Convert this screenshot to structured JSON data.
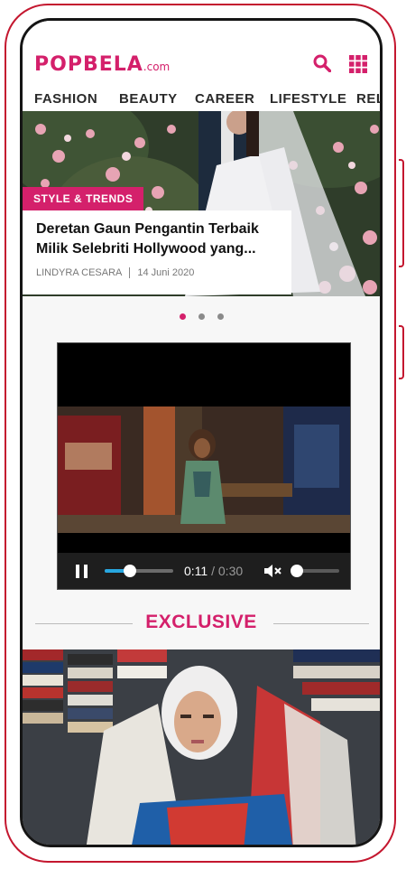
{
  "brand": {
    "name": "POPBELA",
    "suffix": ".com",
    "color": "#d4206b"
  },
  "header_icons": [
    "search-icon",
    "grid-menu-icon"
  ],
  "nav": {
    "items": [
      "FASHION",
      "BEAUTY",
      "CAREER",
      "LIFESTYLE",
      "REL"
    ]
  },
  "hero": {
    "category": "STYLE & TRENDS",
    "title": "Deretan Gaun Pengantin Terbaik Milik Selebriti Hollywood yang...",
    "author": "LINDYRA CESARA",
    "date": "14 Juni 2020",
    "slides": 3,
    "active_slide": 1
  },
  "video": {
    "current_time": "0:11",
    "total_time": "0:30",
    "progress": 0.37,
    "volume": 0,
    "muted": true,
    "accent": "#28a7e0"
  },
  "exclusive": {
    "title": "EXCLUSIVE"
  }
}
